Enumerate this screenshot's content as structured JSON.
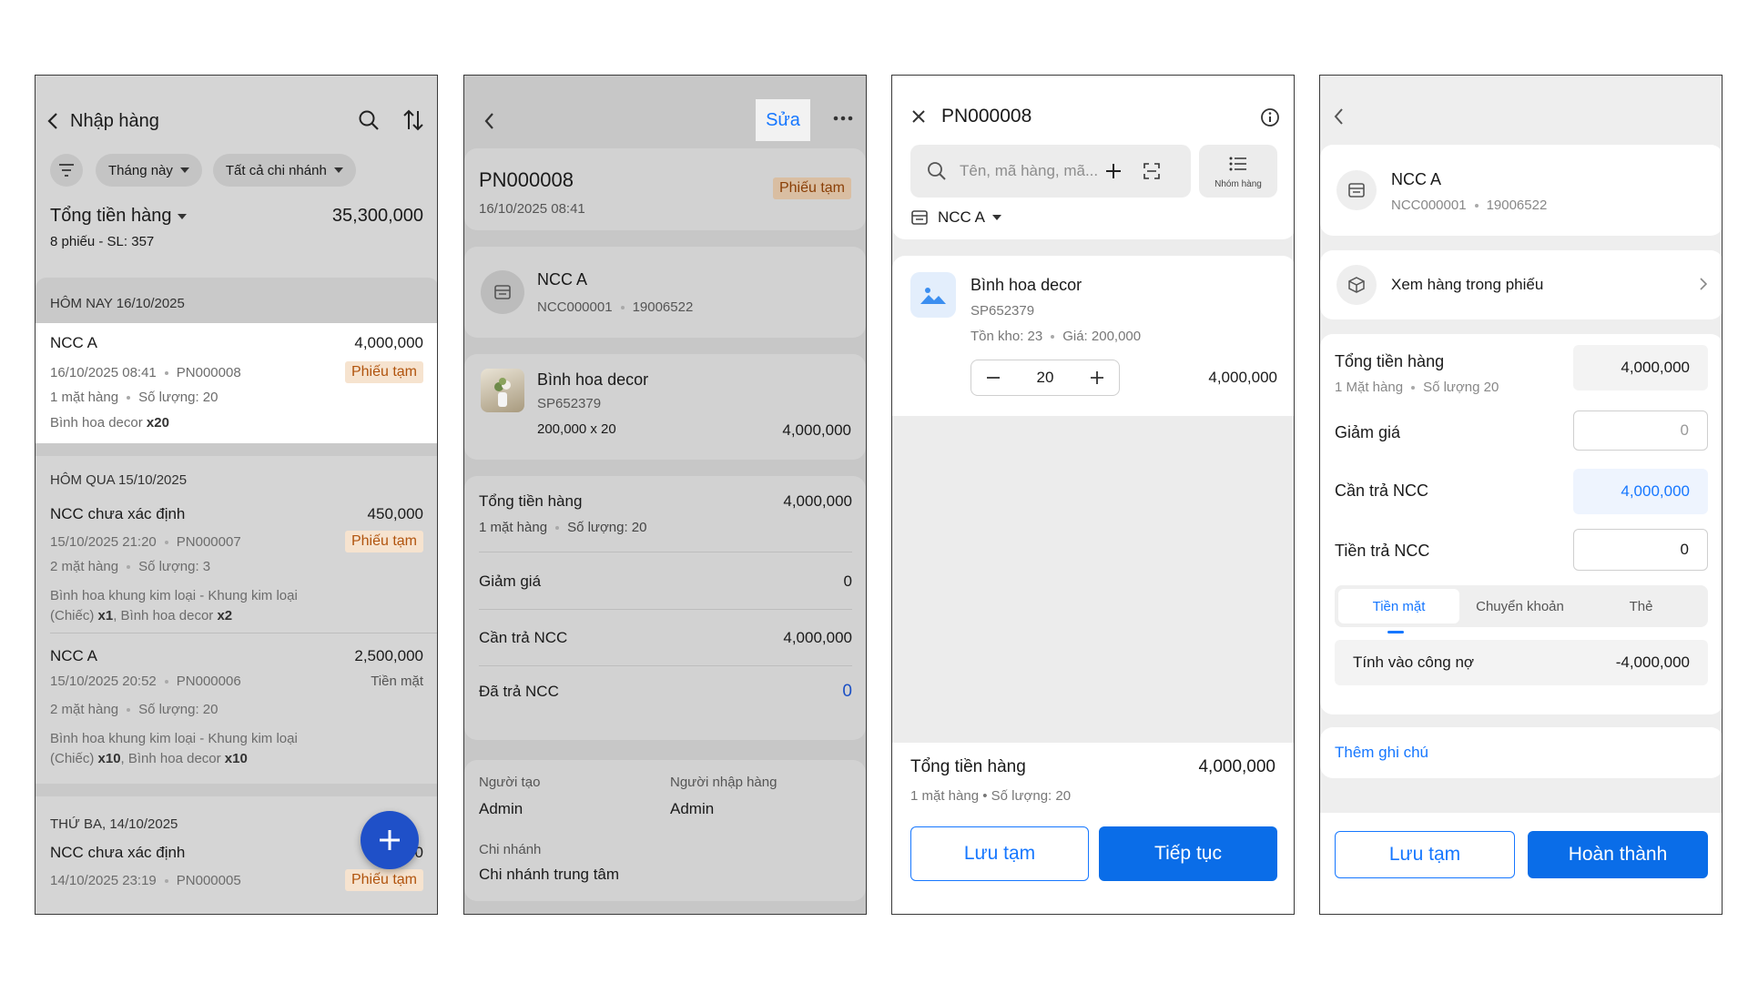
{
  "screen1": {
    "title": "Nhập hàng",
    "filter_month": "Tháng này",
    "filter_branch": "Tất cả chi nhánh",
    "total_label": "Tổng tiền hàng",
    "total_value": "35,300,000",
    "total_sub": "8 phiếu - SL: 357",
    "groups": [
      {
        "header": "HÔM NAY 16/10/2025"
      },
      {
        "header": "HÔM QUA 15/10/2025"
      },
      {
        "header": "THỨ BA, 14/10/2025"
      }
    ],
    "items": [
      {
        "name": "NCC A",
        "amount": "4,000,000",
        "datetime": "16/10/2025 08:41",
        "code": "PN000008",
        "status": "Phiếu tạm",
        "count": "1 mặt hàng",
        "qty": "Số lượng: 20",
        "products": "Bình hoa decor",
        "products_qty": "x20"
      },
      {
        "name": "NCC chưa xác định",
        "amount": "450,000",
        "datetime": "15/10/2025 21:20",
        "code": "PN000007",
        "status": "Phiếu tạm",
        "count": "2 mặt hàng",
        "qty": "Số lượng: 3",
        "products_line1": "Bình hoa khung kim loại - Khung kim loại",
        "products_line2": "(Chiếc)",
        "q1": "x1",
        "p2": ", Bình hoa decor",
        "q2": "x2"
      },
      {
        "name": "NCC A",
        "amount": "2,500,000",
        "datetime": "15/10/2025 20:52",
        "code": "PN000006",
        "status": "Tiền mặt",
        "count": "2 mặt hàng",
        "qty": "Số lượng: 20",
        "products_line1": "Bình hoa khung kim loại - Khung kim loại",
        "products_line2": "(Chiếc)",
        "q1": "x10",
        "p2": ", Bình hoa decor",
        "q2": "x10"
      },
      {
        "name": "NCC chưa xác định",
        "amount": "0",
        "datetime": "14/10/2025 23:19",
        "code": "PN000005",
        "status": "Phiếu tạm"
      }
    ]
  },
  "screen2": {
    "edit_label": "Sửa",
    "code": "PN000008",
    "datetime": "16/10/2025 08:41",
    "status": "Phiếu tạm",
    "supplier_name": "NCC A",
    "supplier_code": "NCC000001",
    "supplier_phone": "19006522",
    "product_name": "Bình hoa decor",
    "product_sku": "SP652379",
    "product_calc": "200,000 x 20",
    "product_total": "4,000,000",
    "total_label": "Tổng tiền hàng",
    "total_value": "4,000,000",
    "total_sub1": "1 mặt hàng",
    "total_sub2": "Số lượng: 20",
    "discount_label": "Giảm giá",
    "discount_value": "0",
    "need_pay_label": "Cần trả NCC",
    "need_pay_value": "4,000,000",
    "paid_label": "Đã trả NCC",
    "paid_value": "0",
    "creator_label": "Người tạo",
    "creator_value": "Admin",
    "importer_label": "Người nhập hàng",
    "importer_value": "Admin",
    "branch_label": "Chi nhánh",
    "branch_value": "Chi nhánh trung tâm"
  },
  "screen3": {
    "title": "PN000008",
    "search_placeholder": "Tên, mã hàng, mã...",
    "group_label": "Nhóm hàng",
    "supplier": "NCC A",
    "product_name": "Bình hoa decor",
    "product_sku": "SP652379",
    "stock": "Tồn kho: 23",
    "price": "Giá: 200,000",
    "quantity": "20",
    "line_total": "4,000,000",
    "total_label": "Tổng tiền hàng",
    "total_value": "4,000,000",
    "total_sub": "1 mặt hàng • Số lượng: 20",
    "save_label": "Lưu tạm",
    "continue_label": "Tiếp tục"
  },
  "screen4": {
    "supplier_name": "NCC A",
    "supplier_code": "NCC000001",
    "supplier_phone": "19006522",
    "view_items_label": "Xem hàng trong phiếu",
    "total_label": "Tổng tiền hàng",
    "total_sub1": "1 Mặt hàng",
    "total_sub2": "Số lượng 20",
    "total_value": "4,000,000",
    "discount_label": "Giảm giá",
    "discount_value": "0",
    "need_pay_label": "Cần trả NCC",
    "need_pay_value": "4,000,000",
    "pay_label": "Tiền trả NCC",
    "pay_value": "0",
    "methods": [
      "Tiền mặt",
      "Chuyển khoản",
      "Thẻ"
    ],
    "debt_label": "Tính vào công nợ",
    "debt_value": "-4,000,000",
    "note_label": "Thêm ghi chú",
    "save_label": "Lưu tạm",
    "complete_label": "Hoàn thành"
  },
  "colors": {
    "accent": "#0a6de8",
    "orange": "#b1540e",
    "fab": "#1f50c8"
  }
}
